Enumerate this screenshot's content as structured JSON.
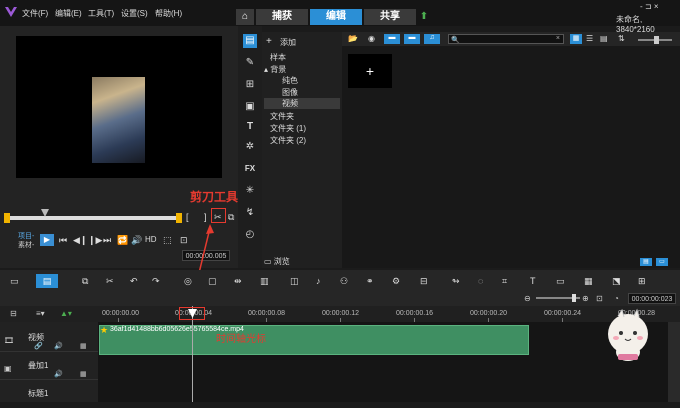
{
  "menu": {
    "items": [
      "文件(F)",
      "编辑(E)",
      "工具(T)",
      "设置(S)",
      "帮助(H)"
    ]
  },
  "tabs": [
    {
      "label": "捕获",
      "active": false
    },
    {
      "label": "编辑",
      "active": true
    },
    {
      "label": "共享",
      "active": false
    }
  ],
  "window": {
    "project_info": "未命名, 3840*2160",
    "controls": "- ⊐ ×"
  },
  "player": {
    "mode_project": "项目-",
    "mode_clip": "素材-",
    "hd_label": "HD",
    "timecode": "00:00:00.005",
    "annotation": "剪刀工具"
  },
  "library": {
    "add_label": "添加",
    "tree": [
      {
        "label": "样本",
        "indent": 0
      },
      {
        "label": "背景",
        "indent": 0
      },
      {
        "label": "纯色",
        "indent": 1
      },
      {
        "label": "图像",
        "indent": 1
      },
      {
        "label": "视频",
        "indent": 1,
        "selected": true
      },
      {
        "label": "文件夹",
        "indent": 0
      },
      {
        "label": "文件夹 (1)",
        "indent": 0
      },
      {
        "label": "文件夹 (2)",
        "indent": 0
      }
    ],
    "browse_label": "浏览",
    "search_value": "",
    "add_box": "+"
  },
  "timeline": {
    "timecode": "00:00:00:023",
    "ruler": [
      "00:00:00.00",
      "00:00:00.04",
      "00:00:00.08",
      "00:00:00.12",
      "00:00:00.16",
      "00:00:00.20",
      "00:00:00.24",
      "00:00:00.28"
    ],
    "tracks": [
      {
        "name": "视频"
      },
      {
        "name": "叠加1"
      },
      {
        "name": "标题1"
      }
    ],
    "clip_name": "36af1d41488bb6d05626e55765584ce.mp4",
    "annotation": "时间轴光标"
  },
  "colors": {
    "accent": "#2b8fd6",
    "clip": "#3f8f62",
    "annotation": "#e53a2f",
    "scrub_handle": "#f2b400"
  }
}
